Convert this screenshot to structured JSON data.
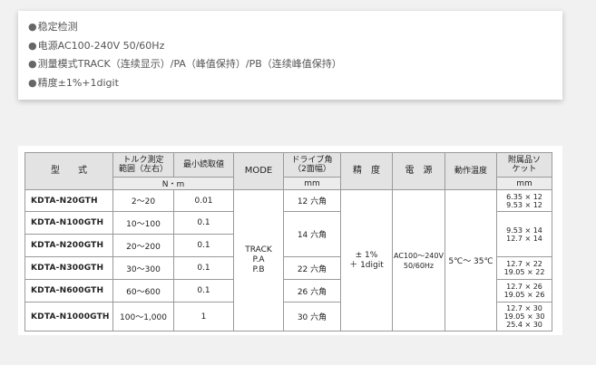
{
  "features": [
    {
      "bullet": "●",
      "text": "稳定检测"
    },
    {
      "bullet": "●",
      "text": "电源AC100-240V 50/60Hz"
    },
    {
      "bullet": "●",
      "text": "测量模式TRACK（连续显示）/PA（峰值保持）/PB（连续峰值保持）"
    },
    {
      "bullet": "●",
      "text": "精度±1%+1digit"
    }
  ],
  "table": {
    "headers": {
      "model": "型　　式",
      "range": "トルク測定\n範囲（左右）",
      "min_reading": "最小読取値",
      "mode": "MODE",
      "drive": "ドライブ角\n（2面幅）",
      "accuracy": "精　度",
      "power": "電　源",
      "temp": "動作温度",
      "accessory": "附属品ソ\nケット"
    },
    "units": {
      "torque": "N・m",
      "drive": "mm",
      "accessory": "mm"
    },
    "rows": [
      {
        "model": "KDTA-N20GTH",
        "range": "2～20",
        "min": "0.01",
        "drive": "12 六角",
        "acc": [
          "6.35 × 12",
          "9.53 × 12"
        ]
      },
      {
        "model": "KDTA-N100GTH",
        "range": "10～100",
        "min": "0.1",
        "drive": "14 六角",
        "acc": [
          "9.53 × 14",
          "12.7 × 14"
        ]
      },
      {
        "model": "KDTA-N200GTH",
        "range": "20～200",
        "min": "0.1",
        "drive": "",
        "acc": []
      },
      {
        "model": "KDTA-N300GTH",
        "range": "30～300",
        "min": "0.1",
        "drive": "22 六角",
        "acc": [
          "12.7 × 22",
          "19.05 × 22"
        ]
      },
      {
        "model": "KDTA-N600GTH",
        "range": "60～600",
        "min": "0.1",
        "drive": "26 六角",
        "acc": [
          "12.7 × 26",
          "19.05 × 26"
        ]
      },
      {
        "model": "KDTA-N1000GTH",
        "range": "100～1,000",
        "min": "1",
        "drive": "30 六角",
        "acc": [
          "12.7 × 30",
          "19.05 × 30",
          "25.4 × 30"
        ]
      }
    ],
    "shared": {
      "mode": [
        "TRACK",
        "P.A",
        "P.B"
      ],
      "accuracy": [
        "± 1%",
        "＋ 1digit"
      ],
      "power": [
        "AC100～240V",
        "50/60Hz"
      ],
      "temp": "5℃～ 35℃"
    }
  }
}
